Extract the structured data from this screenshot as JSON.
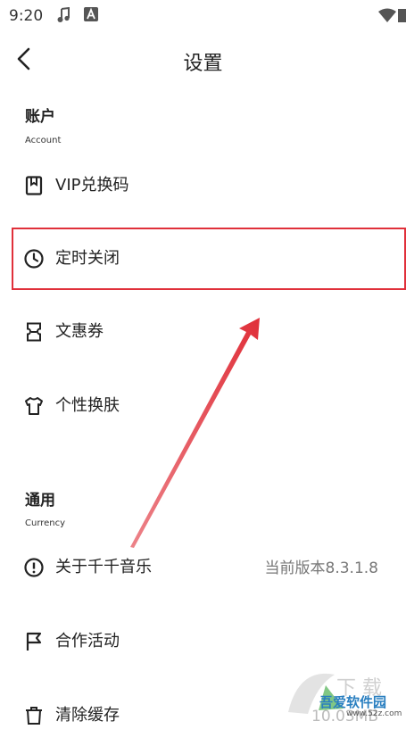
{
  "status_bar": {
    "time": "9:20"
  },
  "header": {
    "title": "设置"
  },
  "account": {
    "title": "账户",
    "subtitle": "Account"
  },
  "account_items": {
    "vip": "VIP兑换码",
    "timer": "定时关闭",
    "coupon": "文惠券",
    "skin": "个性换肤"
  },
  "general": {
    "title": "通用",
    "subtitle": "Currency"
  },
  "general_items": {
    "about": "关于千千音乐",
    "about_value": "当前版本8.3.1.8",
    "partner": "合作活动",
    "cache": "清除缓存",
    "cache_value": "10.03MB"
  },
  "watermark": {
    "text": "吾爱软件园",
    "url": "www.52z.com"
  },
  "colors": {
    "highlight": "#e0303a",
    "text": "#222222",
    "secondary": "#777777"
  }
}
